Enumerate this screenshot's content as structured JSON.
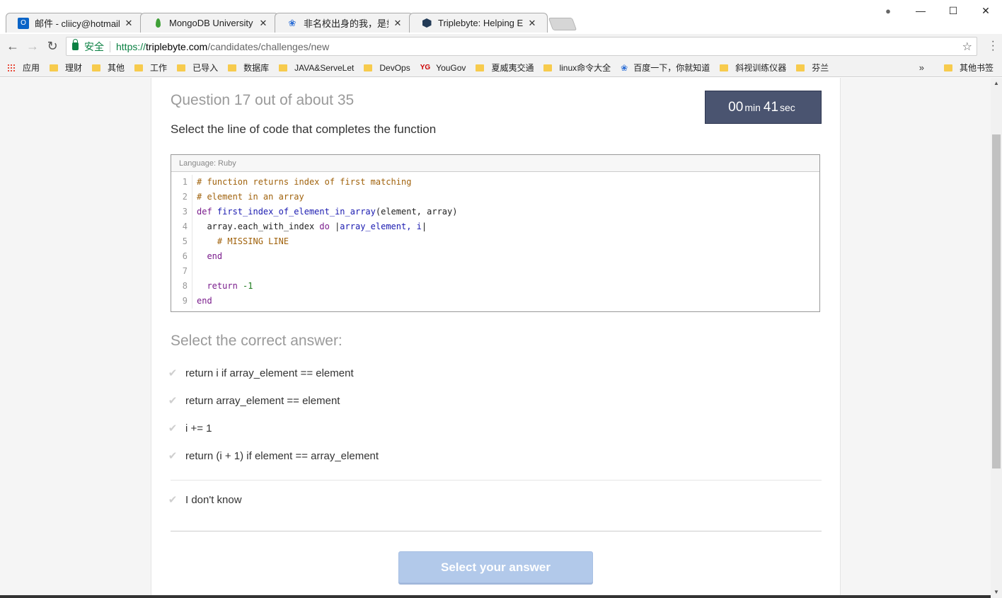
{
  "tabs": [
    {
      "title": "邮件 - cliicy@hotmail.c",
      "active": false,
      "favicon": "outlook-icon"
    },
    {
      "title": "MongoDB University",
      "active": false,
      "favicon": "mongodb-leaf-icon"
    },
    {
      "title": "非名校出身的我，是如何",
      "active": false,
      "favicon": "baidu-paw-icon"
    },
    {
      "title": "Triplebyte: Helping Enc",
      "active": true,
      "favicon": "triplebyte-icon"
    }
  ],
  "window_controls": {
    "account": "●",
    "minimize": "—",
    "maximize": "☐",
    "close": "✕"
  },
  "toolbar": {
    "back": "←",
    "forward": "→",
    "reload": "↻",
    "secure_label": "安全",
    "url_scheme": "https://",
    "url_host": "triplebyte.com",
    "url_path": "/candidates/challenges/new",
    "star": "☆"
  },
  "bookmarks": {
    "apps_label": "应用",
    "items": [
      "理财",
      "其他",
      "工作",
      "已导入",
      "数据库",
      "JAVA&ServeLet",
      "DevOps",
      "YouGov",
      "夏威夷交通",
      "linux命令大全",
      "百度一下，你就知道",
      "斜视训练仪器",
      "芬兰"
    ],
    "yougov_badge": "YG",
    "more": "»",
    "other_label": "其他书签"
  },
  "question": {
    "title": "Question 17 out of about 35",
    "timer_min": "00",
    "timer_min_unit": "min",
    "timer_sec": "41",
    "timer_sec_unit": "sec",
    "prompt": "Select the line of code that completes the function"
  },
  "code": {
    "language": "Language: Ruby",
    "line_numbers": [
      "1",
      "2",
      "3",
      "4",
      "5",
      "6",
      "7",
      "8",
      "9"
    ],
    "l1": "# function returns index of first matching",
    "l2": "# element in an array",
    "l3_def": "def ",
    "l3_fn": "first_index_of_element_in_array",
    "l3_args": "(element, array)",
    "l4_pre": "  array.each_with_index ",
    "l4_do": "do",
    "l4_bar1": " |",
    "l4_var": "array_element, i",
    "l4_bar2": "|",
    "l5": "    # MISSING LINE",
    "l6": "  end",
    "l7": "",
    "l8_kw": "  return ",
    "l8_num": "-1",
    "l9": "end"
  },
  "answers": {
    "heading": "Select the correct answer:",
    "options": [
      "return i if array_element == element",
      "return array_element == element",
      "i += 1",
      "return (i + 1) if element == array_element"
    ],
    "dont_know": "I don't know",
    "check_glyph": "✔"
  },
  "submit_label": "Select your answer"
}
